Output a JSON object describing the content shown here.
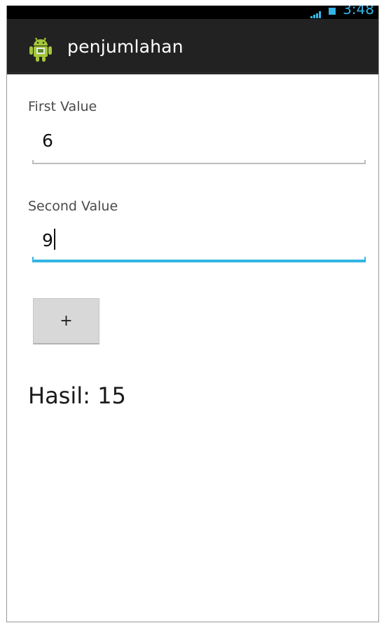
{
  "status_bar": {
    "clock": "3:48",
    "signal_icon": "signal-icon",
    "battery_icon": "battery-icon"
  },
  "action_bar": {
    "app_icon": "android-robot-icon",
    "title": "penjumlahan"
  },
  "form": {
    "first_label": "First Value",
    "first_value": "6",
    "second_label": "Second Value",
    "second_value": "9",
    "button_label": "+"
  },
  "result": {
    "text": "Hasil: 15"
  },
  "colors": {
    "action_bar_bg": "#222222",
    "status_bar_bg": "#000000",
    "focus_accent": "#33b5e5",
    "button_bg": "#d8d8d8",
    "android_green": "#a4c639"
  }
}
